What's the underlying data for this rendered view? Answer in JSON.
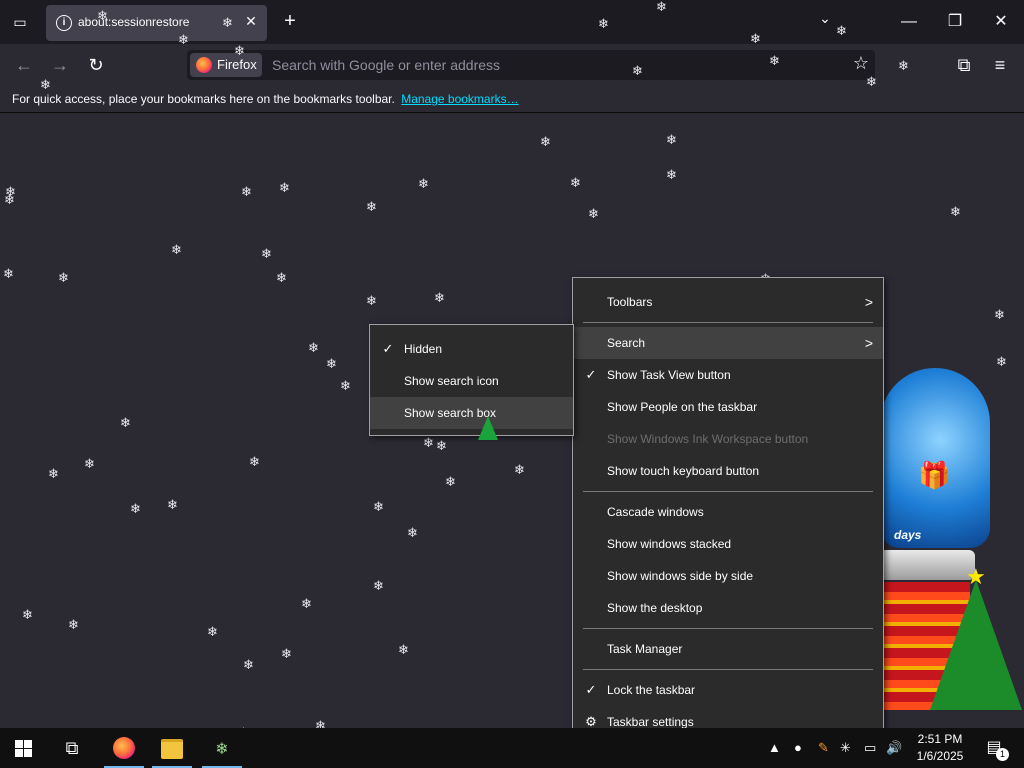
{
  "browser": {
    "tab": {
      "title": "about:sessionrestore",
      "icon": "info-icon"
    },
    "new_tab_icon": "plus-icon",
    "urlbar": {
      "identity_label": "Firefox",
      "placeholder": "Search with Google or enter address"
    },
    "bookmarks_bar": {
      "message": "For quick access, place your bookmarks here on the bookmarks toolbar.",
      "link": "Manage bookmarks…"
    }
  },
  "taskbar_menu": {
    "items": [
      {
        "label": "Toolbars",
        "submenu": true
      },
      {
        "label": "Search",
        "submenu": true,
        "highlighted": true
      },
      {
        "label": "Show Task View button",
        "checked": true
      },
      {
        "label": "Show People on the taskbar"
      },
      {
        "label": "Show Windows Ink Workspace button",
        "disabled": true
      },
      {
        "label": "Show touch keyboard button"
      },
      {
        "label": "Cascade windows"
      },
      {
        "label": "Show windows stacked"
      },
      {
        "label": "Show windows side by side"
      },
      {
        "label": "Show the desktop"
      },
      {
        "label": "Task Manager"
      },
      {
        "label": "Lock the taskbar",
        "checked": true
      },
      {
        "label": "Taskbar settings",
        "icon": "gear-icon"
      }
    ]
  },
  "search_submenu": {
    "items": [
      {
        "label": "Hidden",
        "checked": true
      },
      {
        "label": "Show search icon"
      },
      {
        "label": "Show search box",
        "highlighted": true
      }
    ]
  },
  "decoration": {
    "globe_text": "days"
  },
  "taskbar": {
    "clock_time": "2:51 PM",
    "clock_date": "1/6/2025",
    "notification_count": "1"
  },
  "colors": {
    "browser_bg": "#2b2a33",
    "tabstrip_bg": "#1c1b22",
    "menu_bg": "#2b2b2b",
    "menu_hover": "#414141",
    "link": "#00ddff",
    "taskbar_bg": "#101010"
  }
}
